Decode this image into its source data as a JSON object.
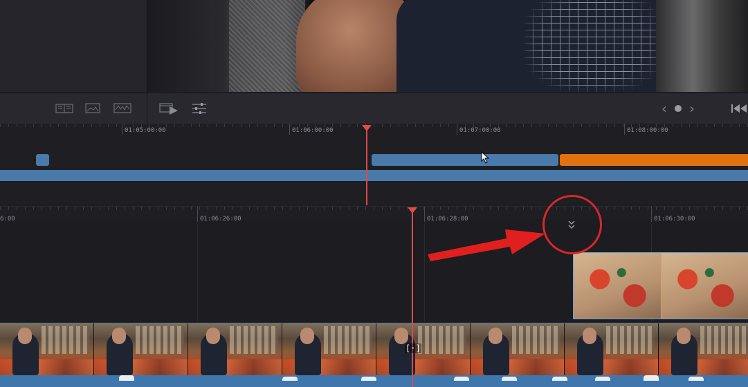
{
  "icons": {
    "compare_view": "clip-compare-icon",
    "image_view": "image-view-icon",
    "scope_view": "waveform-scope-icon",
    "playback": "play-filmstrip-icon",
    "adjust": "sliders-adjust-icon",
    "nav_prev": "chevron-left-icon",
    "nav_dot": "dot-icon",
    "nav_next": "chevron-right-icon",
    "skip_back": "skip-to-start-icon",
    "expand": "chevron-double-down-icon",
    "cursor": "mouse-pointer-icon"
  },
  "toolbar": {
    "nav_prev": "‹",
    "nav_next": "›"
  },
  "upper_timeline": {
    "timecodes": [
      "01:05:00:00",
      "01:06:00:00",
      "01:07:00:00",
      "01:08:00:00"
    ]
  },
  "lower_timeline": {
    "timecodes": [
      "6:00",
      "01:06:26:00",
      "01:06:28:00",
      "01:06:30:00"
    ],
    "in_out_marker": "[·]"
  },
  "colors": {
    "accent_blue": "#4a7aaa",
    "clip_orange": "#e2710f",
    "playhead_red": "#e04a4a",
    "annotation_red": "#d8282a"
  }
}
